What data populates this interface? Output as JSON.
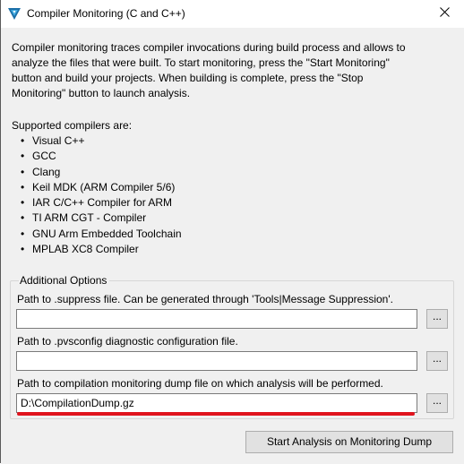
{
  "window": {
    "title": "Compiler Monitoring (C and C++)"
  },
  "description": "Compiler monitoring traces compiler invocations during build process and allows to\nanalyze the files that were built. To start monitoring, press the \"Start Monitoring\"\nbutton and build your projects. When building is complete, press the \"Stop\nMonitoring\" button to launch analysis.",
  "supported": {
    "title": "Supported compilers are:",
    "items": [
      "Visual C++",
      "GCC",
      "Clang",
      "Keil MDK (ARM Compiler 5/6)",
      "IAR C/C++ Compiler for ARM",
      "TI ARM CGT - Compiler",
      "GNU Arm Embedded Toolchain",
      "MPLAB XC8 Compiler"
    ]
  },
  "options": {
    "group_title": "Additional Options",
    "suppress": {
      "label": "Path to .suppress file. Can be generated through 'Tools|Message Suppression'.",
      "value": "",
      "browse_label": "..."
    },
    "pvsconfig": {
      "label": "Path to .pvsconfig diagnostic configuration file.",
      "value": "",
      "browse_label": "..."
    },
    "dump": {
      "label": "Path to compilation monitoring dump file on which analysis will be performed.",
      "value": "D:\\CompilationDump.gz",
      "browse_label": "..."
    }
  },
  "actions": {
    "start_analysis_label": "Start Analysis on Monitoring Dump"
  },
  "colors": {
    "accent_underline": "#e0141e",
    "app_icon": "#1b6fa8"
  }
}
